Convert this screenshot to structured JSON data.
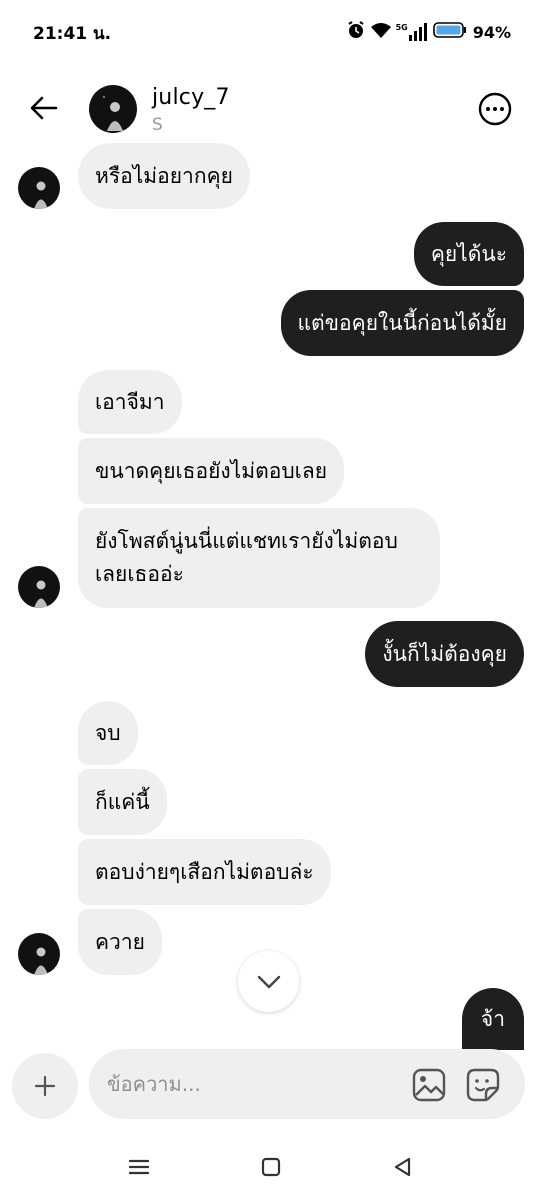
{
  "status_bar": {
    "time": "21:41 น.",
    "battery": "94%",
    "network": "5G"
  },
  "header": {
    "username": "julcy_7",
    "subtitle": "S"
  },
  "messages": [
    {
      "side": "in",
      "text": "หรือไม่อยากคุย"
    },
    {
      "side": "out",
      "text": "คุยได้นะ"
    },
    {
      "side": "out",
      "text": "แต่ขอคุยในนี้ก่อนได้มั้ย"
    },
    {
      "side": "in",
      "text": "เอาจีมา"
    },
    {
      "side": "in",
      "text": "ขนาดคุยเธอยังไม่ตอบเลย"
    },
    {
      "side": "in",
      "text": "ยังโพสต์นู่นนี่แต่แชทเรายังไม่ตอบเลยเธออ่ะ"
    },
    {
      "side": "out",
      "text": "งั้นก็ไม่ต้องคุย"
    },
    {
      "side": "in",
      "text": "จบ"
    },
    {
      "side": "in",
      "text": "ก็แค่นี้"
    },
    {
      "side": "in",
      "text": "ตอบง่ายๆเสือกไม่ตอบล่ะ"
    },
    {
      "side": "in",
      "text": "ควาย"
    },
    {
      "side": "out",
      "text": "จ้า"
    }
  ],
  "composer": {
    "placeholder": "ข้อความ..."
  },
  "colors": {
    "incoming_bubble": "#efefef",
    "outgoing_bubble": "#1f1f1f",
    "subtitle": "#9a9a9a"
  }
}
